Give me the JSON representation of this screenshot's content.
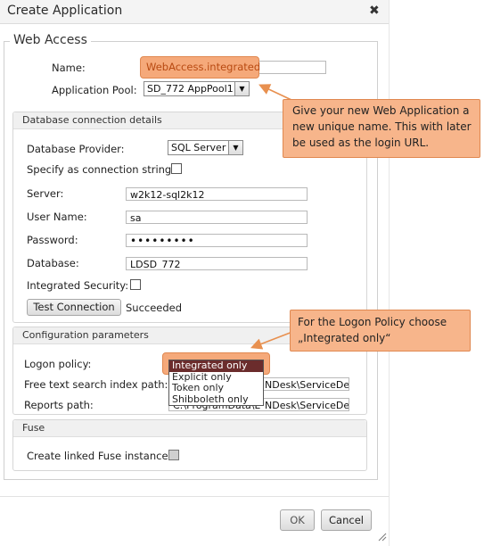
{
  "dialog": {
    "title": "Create Application",
    "close_icon": "close-icon",
    "ok_label": "OK",
    "cancel_label": "Cancel"
  },
  "web_access": {
    "legend": "Web Access",
    "name_label": "Name:",
    "name_value": "WebAccess.integrated",
    "pool_label": "Application Pool:",
    "pool_value": "SD_772 AppPool1"
  },
  "database": {
    "header": "Database connection details",
    "provider_label": "Database Provider:",
    "provider_value": "SQL Server",
    "connstring_label": "Specify as connection string?",
    "server_label": "Server:",
    "server_value": "w2k12-sql2k12",
    "user_label": "User Name:",
    "user_value": "sa",
    "password_label": "Password:",
    "password_value": "•••••••••",
    "db_label": "Database:",
    "db_value": "LDSD_772",
    "integrated_label": "Integrated Security:",
    "test_button": "Test Connection",
    "test_status": "Succeeded"
  },
  "config": {
    "header": "Configuration parameters",
    "logon_label": "Logon policy:",
    "logon_options": [
      "Integrated only",
      "Explicit only",
      "Token only",
      "Shibboleth only"
    ],
    "logon_selected": "Integrated only",
    "fts_label": "Free text search index path:",
    "fts_value": "C:\\ProgramData\\LANDesk\\ServiceDes",
    "fts_visible_tail": "NDesk\\ServiceDes",
    "reports_label": "Reports path:",
    "reports_value_a": "C:\\ProgramData\\L",
    "reports_value_b": "NDesk\\ServiceDes"
  },
  "fuse": {
    "header": "Fuse",
    "linked_label": "Create linked Fuse instance:"
  },
  "callouts": {
    "name_tip": "Give your new Web Application a new unique name. This with later be used as the login URL.",
    "logon_tip": "For the Logon Policy choose „Integrated only“"
  },
  "colors": {
    "callout_fill": "#f7b58b",
    "callout_border": "#e08850",
    "dropdown_selected": "#6b2c2c"
  }
}
